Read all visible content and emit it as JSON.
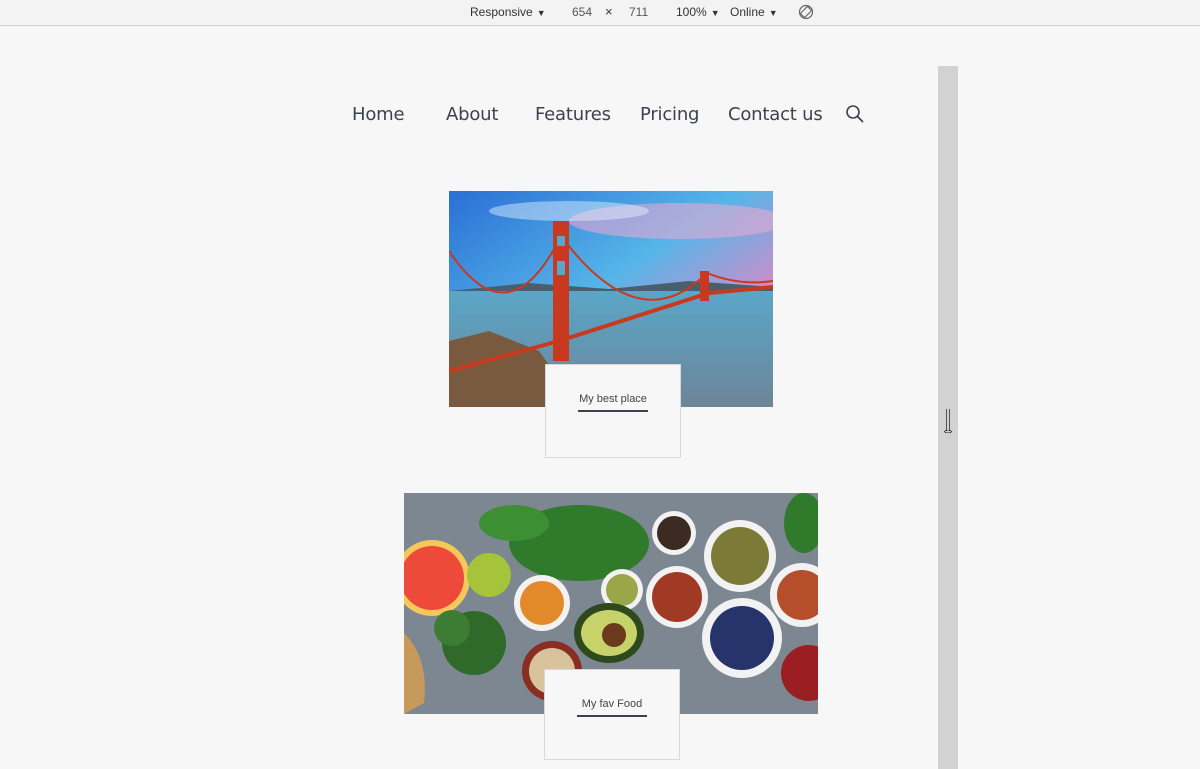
{
  "toolbar": {
    "device": "Responsive",
    "width": "654",
    "times": "×",
    "height": "711",
    "zoom": "100%",
    "network": "Online",
    "rotate_icon": "rotate-icon"
  },
  "nav": {
    "items": [
      "Home",
      "About",
      "Features",
      "Pricing",
      "Contact us"
    ],
    "search_icon": "search-icon"
  },
  "cards": [
    {
      "caption": "My best place",
      "image": "golden-gate-bridge-image"
    },
    {
      "caption": "My fav Food",
      "image": "healthy-food-image"
    }
  ],
  "colors": {
    "nav_text": "#3c4250",
    "caption_underline": "#3c4250",
    "page_bg": "#f7f7f7"
  }
}
